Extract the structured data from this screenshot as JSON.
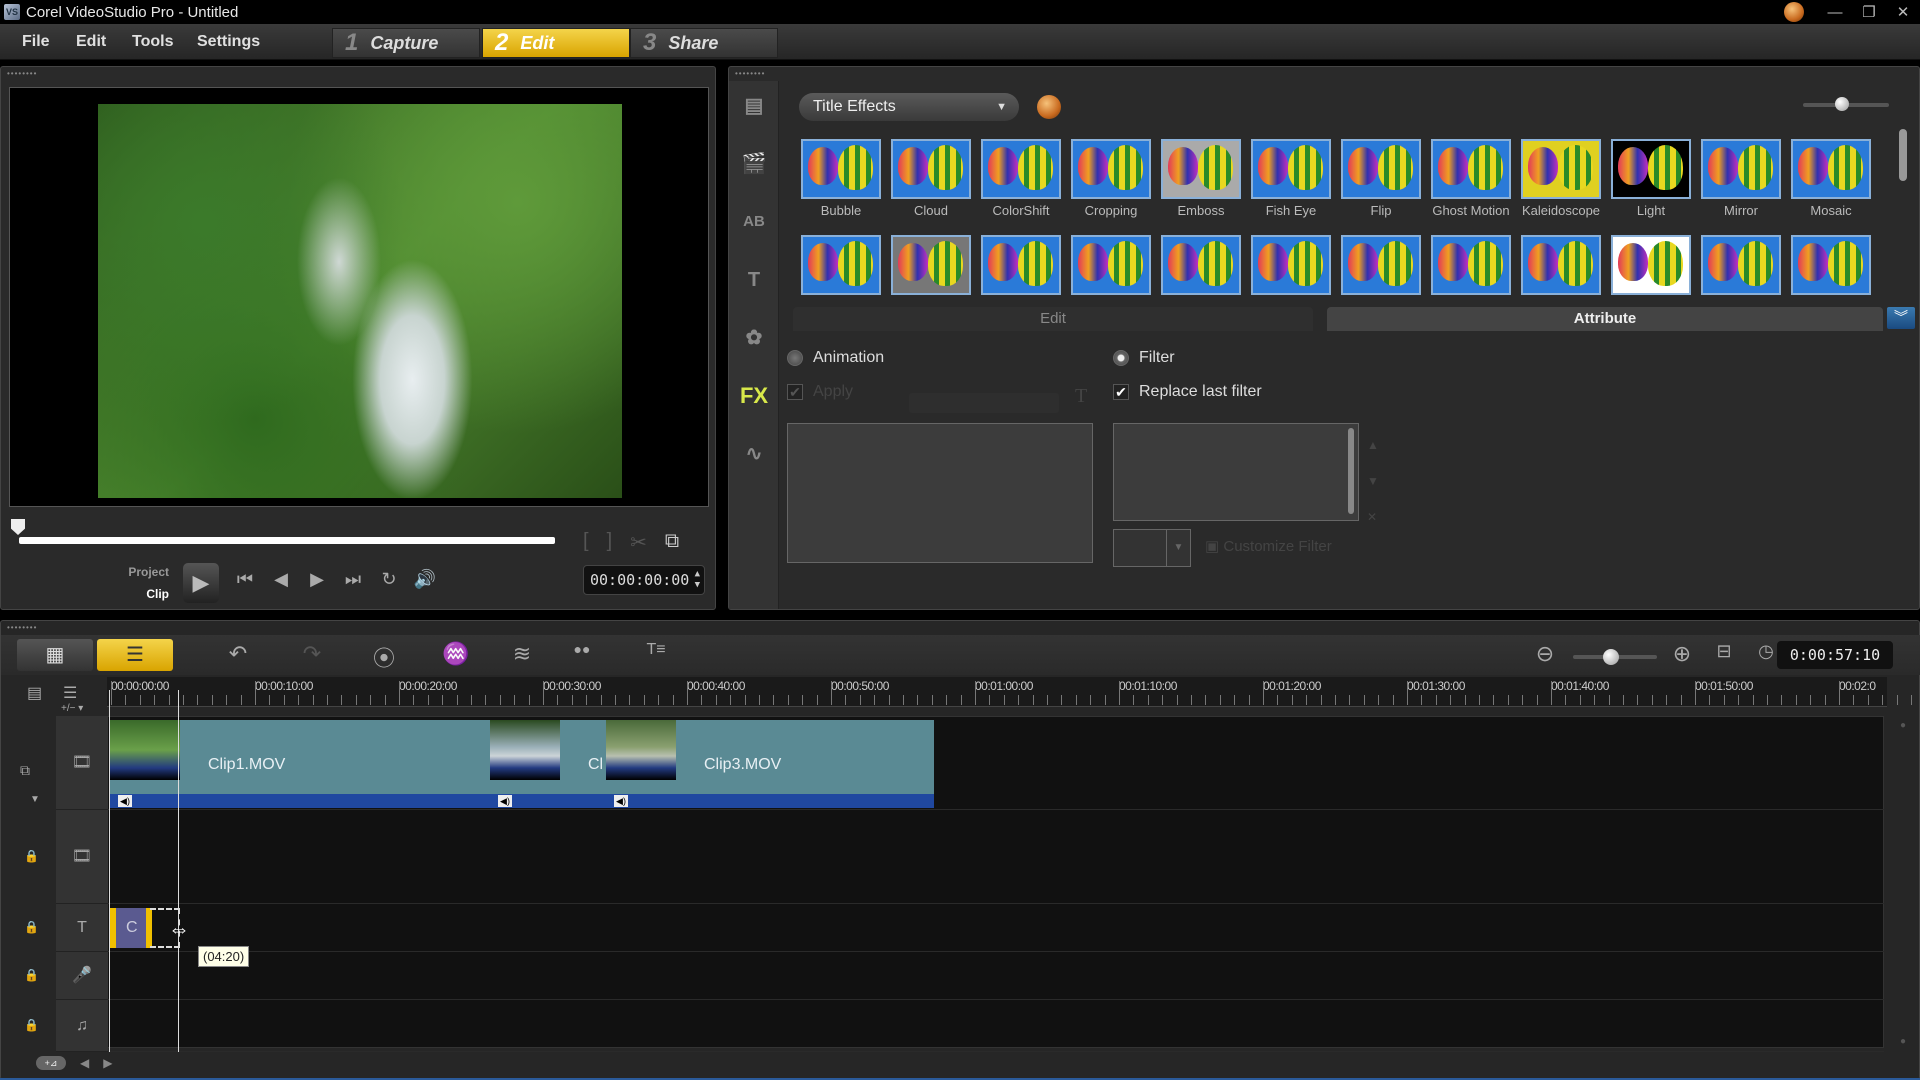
{
  "window": {
    "title": "Corel VideoStudio Pro - Untitled",
    "app_icon": "VS",
    "controls": [
      "—",
      "❐",
      "✕"
    ]
  },
  "menu": {
    "items": [
      "File",
      "Edit",
      "Tools",
      "Settings"
    ]
  },
  "steps": [
    {
      "num": "1",
      "label": "Capture",
      "active": false
    },
    {
      "num": "2",
      "label": "Edit",
      "active": true
    },
    {
      "num": "3",
      "label": "Share",
      "active": false
    }
  ],
  "preview": {
    "mode_labels": {
      "project": "Project",
      "clip": "Clip"
    },
    "timecode": "00:00:00:00",
    "transport_icons": [
      "⏮",
      "◀",
      "▶",
      "⏭",
      "↻",
      "🔊"
    ],
    "trim_icons": [
      "[",
      "]",
      "✂",
      "⧉"
    ],
    "play_icon": "▶"
  },
  "library": {
    "category": "Title Effects",
    "sidebar_icons": [
      "media-icon",
      "instant-project-icon",
      "transition-icon",
      "title-icon",
      "graphic-icon",
      "filter-fx-icon",
      "path-icon"
    ],
    "sidebar_glyphs": [
      "▤",
      "🎬",
      "AB",
      "T",
      "✿",
      "FX",
      "∿"
    ],
    "effects_row1": [
      "Bubble",
      "Cloud",
      "ColorShift",
      "Cropping",
      "Emboss",
      "Fish Eye",
      "Flip",
      "Ghost Motion",
      "Kaleidoscope",
      "Light",
      "Mirror",
      "Mosaic"
    ],
    "effects_row2_count": 12,
    "tabs": {
      "edit": "Edit",
      "attribute": "Attribute"
    },
    "expand_icon": "︾",
    "options": {
      "animation": "Animation",
      "apply": "Apply",
      "filter": "Filter",
      "replace_last_filter": "Replace last filter",
      "customize_filter": "Customize Filter"
    },
    "filter_selected": "Filter",
    "replace_last_filter_checked": true
  },
  "timeline": {
    "toolbar_icons": [
      "undo-icon",
      "redo-icon",
      "record-capture-icon",
      "sound-mixer-icon",
      "auto-music-icon",
      "motion-tracking-icon",
      "subtitle-editor-icon"
    ],
    "toolbar_glyphs": [
      "↶",
      "↷",
      "⦿",
      "♒",
      "≋",
      "●●",
      "T≡"
    ],
    "duration": "0:00:57:10",
    "zoom_level": 0.45,
    "ruler_labels": [
      "00:00:00:00",
      "00:00:10:00",
      "00:00:20:00",
      "00:00:30:00",
      "00:00:40:00",
      "00:00:50:00",
      "00:01:00:00",
      "00:01:10:00",
      "00:01:20:00",
      "00:01:30:00",
      "00:01:40:00",
      "00:01:50:00",
      "00:02:0"
    ],
    "track_icons": [
      "video-track-icon",
      "overlay-track-icon",
      "title-track-icon",
      "voice-track-icon",
      "music-track-icon"
    ],
    "track_glyphs": [
      "🎞",
      "🎞",
      "T",
      "🎤",
      "♫"
    ],
    "add_remove": "+/− ▾",
    "clips": [
      {
        "label": "Clip1.MOV"
      },
      {
        "label": "Cl"
      },
      {
        "label": "Clip3.MOV"
      }
    ],
    "title_clip_label": "C",
    "tooltip": "(04:20)"
  }
}
